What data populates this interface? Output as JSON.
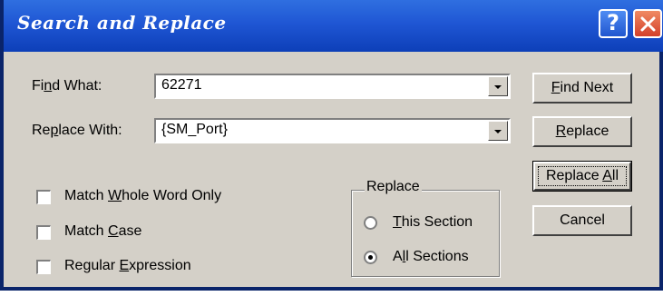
{
  "window": {
    "title": "Search and Replace",
    "help_icon": "help-icon",
    "close_icon": "close-icon"
  },
  "find": {
    "label_pre": "Fi",
    "label_key": "n",
    "label_post": "d What:",
    "value": "62271"
  },
  "replace": {
    "label_pre": "Re",
    "label_key": "p",
    "label_post": "lace With:",
    "value": "{SM_Port}"
  },
  "options": [
    {
      "pre": "Match ",
      "key": "W",
      "post": "hole Word Only",
      "checked": false
    },
    {
      "pre": "Match ",
      "key": "C",
      "post": "ase",
      "checked": false
    },
    {
      "pre": "Regular ",
      "key": "E",
      "post": "xpression",
      "checked": false
    }
  ],
  "scope": {
    "title": "Replace",
    "items": [
      {
        "pre": "",
        "key": "T",
        "post": "his Section",
        "selected": false
      },
      {
        "pre": "A",
        "key": "l",
        "post": "l Sections",
        "selected": true
      }
    ]
  },
  "buttons": {
    "find_next": {
      "key": "F",
      "post": "ind Next"
    },
    "replace": {
      "key": "R",
      "post": "eplace"
    },
    "replace_all": {
      "pre": "Replace ",
      "key": "A",
      "post": "ll"
    },
    "cancel": "Cancel"
  }
}
